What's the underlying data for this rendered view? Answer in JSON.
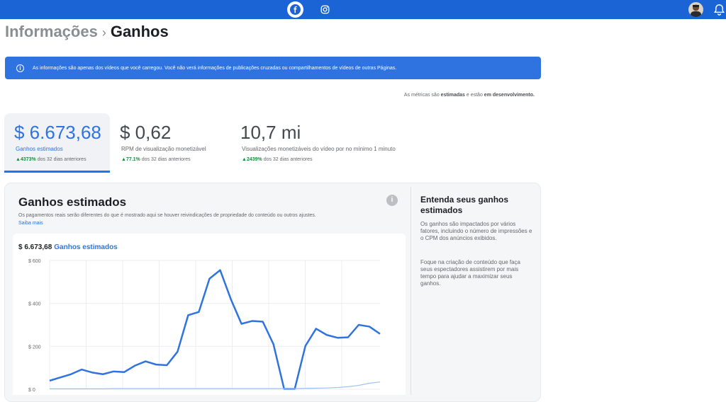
{
  "topbar": {
    "icons": [
      "facebook-icon",
      "instagram-icon",
      "avatar",
      "bell-icon"
    ],
    "color": "#1b64d6"
  },
  "breadcrumb": {
    "parent": "Informações",
    "separator": "›",
    "current": "Ganhos"
  },
  "banner": {
    "text": "As informações são apenas dos vídeos que você carregou. Você não verá informações de publicações cruzadas ou compartilhamentos de vídeos de outras Páginas."
  },
  "note": {
    "prefix": "As métricas são",
    "bold1": "estimadas",
    "middle": "e estão",
    "bold2": "em desenvolvimento."
  },
  "metrics": [
    {
      "value": "$ 6.673,68",
      "label": "Ganhos estimados",
      "change": "4373%",
      "change_suffix": "dos 32 dias anteriores"
    },
    {
      "value": "$ 0,62",
      "label": "RPM de visualização monetizável",
      "change": "77.1%",
      "change_suffix": "dos 32 dias anteriores"
    },
    {
      "value": "10,7 mi",
      "label": "Visualizações monetizáveis do vídeo por no mínimo 1 minuto",
      "change": "2439%",
      "change_suffix": "dos 32 dias anteriores"
    }
  ],
  "card": {
    "title": "Ganhos estimados",
    "subtitle": "Os pagamentos reais serão diferentes do que é mostrado aqui se houver reivindicações de propriedade do conteúdo ou outros ajustes.",
    "link": "Saiba mais",
    "total_amount": "$ 6.673,68",
    "total_label": "Ganhos estimados"
  },
  "side": {
    "title": "Entenda seus ganhos estimados",
    "p1": "Os ganhos são impactados por vários fatores, incluindo o número de impressões e o CPM dos anúncios exibidos.",
    "p2": "Foque na criação de conteúdo que faça seus espectadores assistirem por mais tempo para ajudar a maximizar seus ganhos."
  },
  "chart_data": {
    "type": "line",
    "ylim": [
      0,
      600
    ],
    "yticks": [
      {
        "value": 0,
        "label": "$ 0"
      },
      {
        "value": 200,
        "label": "$ 200"
      },
      {
        "value": 400,
        "label": "$ 400"
      },
      {
        "value": 600,
        "label": "$ 600"
      }
    ],
    "grid": true,
    "series": [
      {
        "color": "#2f73e0",
        "values": [
          40,
          55,
          70,
          92,
          78,
          70,
          83,
          80,
          110,
          130,
          115,
          112,
          175,
          345,
          360,
          515,
          555,
          420,
          305,
          318,
          315,
          210,
          2,
          2,
          202,
          282,
          253,
          240,
          242,
          300,
          292,
          258
        ]
      },
      {
        "color": "#9ec1f2",
        "values": [
          2,
          2,
          2,
          2,
          2,
          2,
          3,
          3,
          3,
          3,
          3,
          3,
          3,
          3,
          3,
          3,
          3,
          3,
          3,
          3,
          3,
          3,
          3,
          3,
          4,
          5,
          6,
          8,
          12,
          18,
          28,
          34
        ]
      }
    ]
  }
}
